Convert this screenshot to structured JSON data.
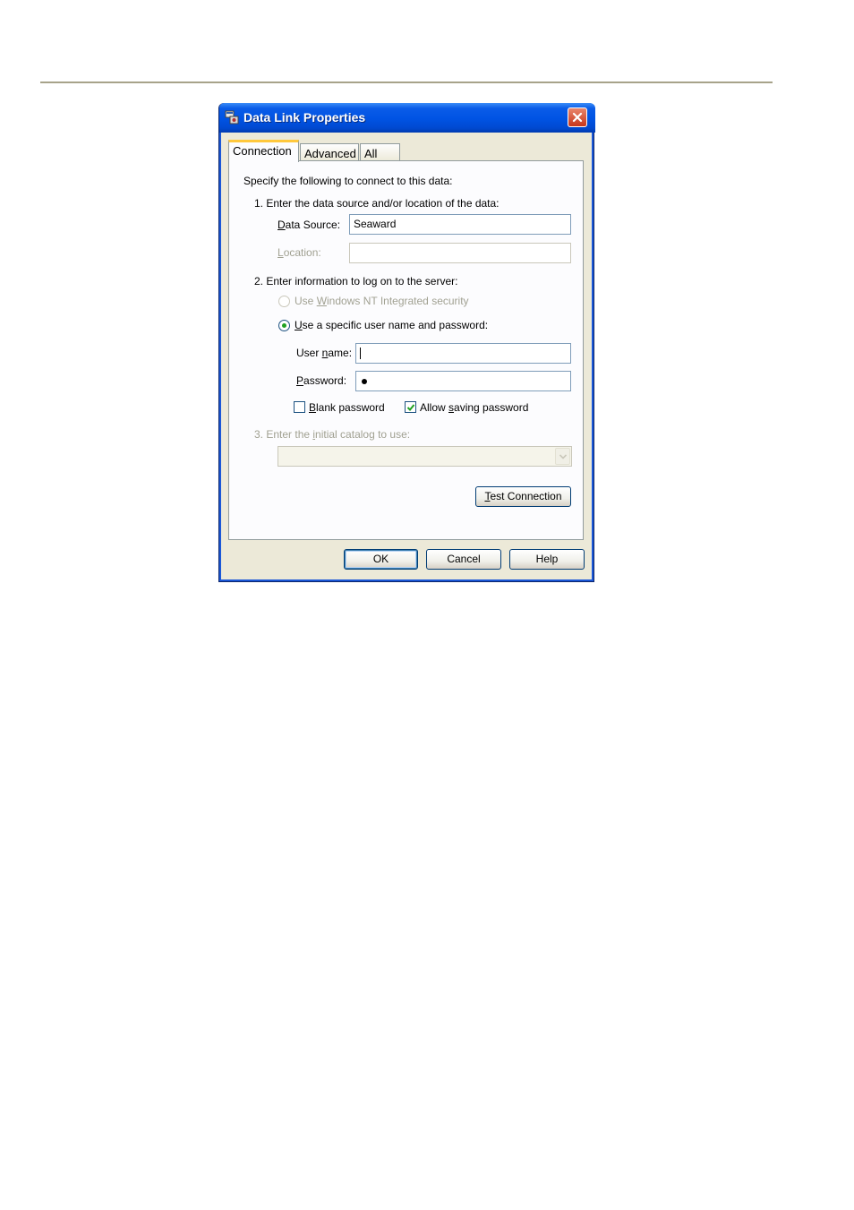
{
  "window": {
    "title": "Data Link Properties"
  },
  "tabs": [
    {
      "label": "Connection",
      "active": true
    },
    {
      "label": "Advanced",
      "active": false
    },
    {
      "label": "All",
      "active": false
    }
  ],
  "connection": {
    "intro": "Specify the following to connect to this data:",
    "step1": "1. Enter the data source and/or location of the data:",
    "data_source": {
      "label_ul": "D",
      "label_rest": "ata Source:",
      "value": "Seaward"
    },
    "location": {
      "label_ul": "L",
      "label_rest": "ocation:",
      "value": ""
    },
    "step2": "2. Enter information to log on to the server:",
    "radio_windows": {
      "pre": "Use ",
      "ul": "W",
      "post": "indows NT Integrated security",
      "selected": false,
      "enabled": false
    },
    "radio_specific": {
      "ul": "U",
      "post": "se a specific user name and password:",
      "selected": true,
      "enabled": true
    },
    "user_name": {
      "pre": "User ",
      "ul": "n",
      "post": "ame:",
      "value": ""
    },
    "password": {
      "ul": "P",
      "post": "assword:",
      "masked_length": 1
    },
    "blank_password": {
      "ul": "B",
      "post": "lank password",
      "checked": false
    },
    "allow_saving": {
      "pre": "Allow ",
      "ul": "s",
      "post": "aving password",
      "checked": true
    },
    "step3": {
      "pre": "3. Enter the ",
      "ul": "i",
      "post": "nitial catalog to use:"
    },
    "catalog_value": "",
    "test_button": {
      "ul": "T",
      "post": "est Connection"
    }
  },
  "footer": {
    "ok": "OK",
    "cancel": "Cancel",
    "help": "Help"
  },
  "colors": {
    "titlebar": "#0053e3",
    "dialog_bg": "#ece9d8",
    "tab_highlight": "#ffc83c",
    "close_button": "#c7361c"
  }
}
